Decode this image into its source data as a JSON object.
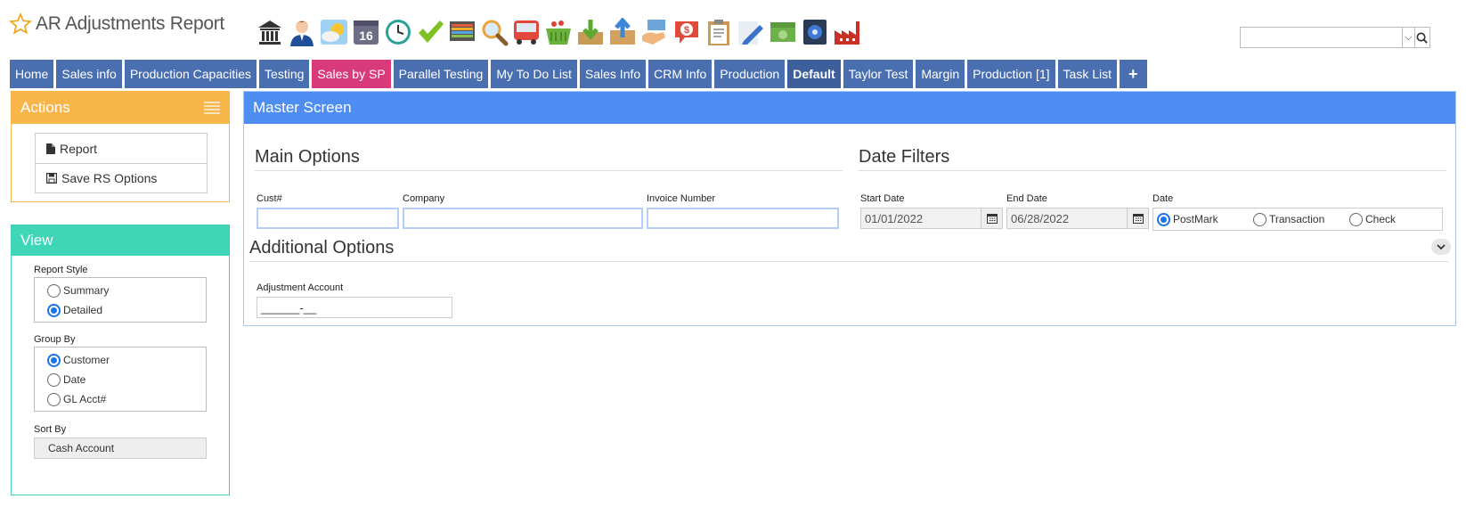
{
  "header": {
    "title": "AR Adjustments Report",
    "icons": [
      "bank-icon",
      "user-icon",
      "weather-icon",
      "calendar-16-icon",
      "clock-icon",
      "checkmark-icon",
      "monitor-icon",
      "magnifier-icon",
      "bus-icon",
      "basket-icon",
      "inbox-download-icon",
      "box-upload-icon",
      "hand-card-icon",
      "dollar-chat-icon",
      "clipboard-icon",
      "pencil-icon",
      "money-icon",
      "safe-icon",
      "factory-icon"
    ],
    "calendar_day": "16"
  },
  "search": {
    "placeholder": "",
    "value": ""
  },
  "tabs": [
    {
      "label": "Home"
    },
    {
      "label": "Sales info"
    },
    {
      "label": "Production Capacities"
    },
    {
      "label": "Testing"
    },
    {
      "label": "Sales by SP"
    },
    {
      "label": "Parallel Testing"
    },
    {
      "label": "My To Do List"
    },
    {
      "label": "Sales Info"
    },
    {
      "label": "CRM Info"
    },
    {
      "label": "Production"
    },
    {
      "label": "Default"
    },
    {
      "label": "Taylor Test"
    },
    {
      "label": "Margin"
    },
    {
      "label": "Production [1]"
    },
    {
      "label": "Task List"
    },
    {
      "label": "+"
    }
  ],
  "actions": {
    "title": "Actions",
    "items": [
      {
        "label": "Report"
      },
      {
        "label": "Save RS Options"
      }
    ]
  },
  "view": {
    "title": "View",
    "report_style": {
      "label": "Report Style",
      "options": [
        "Summary",
        "Detailed"
      ],
      "selected": "Detailed"
    },
    "group_by": {
      "label": "Group By",
      "options": [
        "Customer",
        "Date",
        "GL Acct#"
      ],
      "selected": "Customer"
    },
    "sort_by": {
      "label": "Sort By",
      "value": "Cash Account"
    }
  },
  "master": {
    "title": "Master Screen",
    "main_options": {
      "title": "Main Options",
      "cust_label": "Cust#",
      "cust_value": "",
      "company_label": "Company",
      "company_value": "",
      "invoice_label": "Invoice Number",
      "invoice_value": ""
    },
    "date_filters": {
      "title": "Date Filters",
      "start_label": "Start Date",
      "start_value": "01/01/2022",
      "end_label": "End Date",
      "end_value": "06/28/2022",
      "date_label": "Date",
      "date_options": [
        "PostMark",
        "Transaction",
        "Check"
      ],
      "date_selected": "PostMark"
    },
    "additional_options": {
      "title": "Additional Options",
      "account_label": "Adjustment Account",
      "account_value": "______-__"
    }
  }
}
